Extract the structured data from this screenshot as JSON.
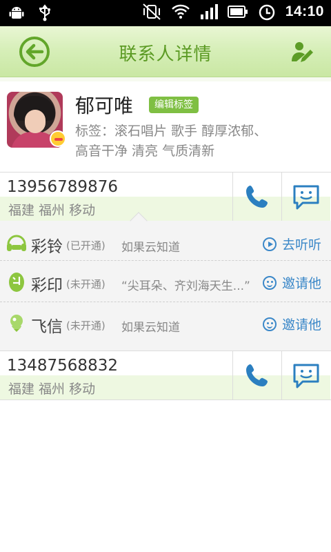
{
  "status_bar": {
    "time": "14:10",
    "left_icons": [
      "android-debug-icon",
      "usb-icon"
    ],
    "right_icons": [
      "mute-vibrate-icon",
      "wifi-icon",
      "signal-icon",
      "battery-icon",
      "alarm-icon"
    ]
  },
  "header": {
    "title": "联系人详情",
    "back_icon": "back-arrow-icon",
    "edit_icon": "edit-contact-icon"
  },
  "contact": {
    "name": "郁可唯",
    "edit_tags_label": "编辑标签",
    "tags_line1": "标签：滚石唱片  歌手  醇厚浓郁、",
    "tags_line2": "高音干净 清亮 气质清新"
  },
  "phones": [
    {
      "number": "13956789876",
      "location": "福建 福州 移动"
    },
    {
      "number": "13487568832",
      "location": "福建 福州 移动"
    }
  ],
  "services": [
    {
      "name": "彩铃",
      "status": "(已开通)",
      "desc": "如果云知道",
      "action": "去听听",
      "action_icon": "play-icon",
      "icon": "music-icon"
    },
    {
      "name": "彩印",
      "status": "(未开通)",
      "desc": "“尖耳朵、齐刘海天生...”",
      "action": "邀请他",
      "action_icon": "smile-icon",
      "icon": "caiyin-icon"
    },
    {
      "name": "飞信",
      "status": "(未开通)",
      "desc": "如果云知道",
      "action": "邀请他",
      "action_icon": "smile-icon",
      "icon": "fetion-icon"
    }
  ],
  "colors": {
    "header_title": "#5b9a23",
    "accent_blue": "#3a87c8",
    "tag_button": "#7fbf43"
  }
}
